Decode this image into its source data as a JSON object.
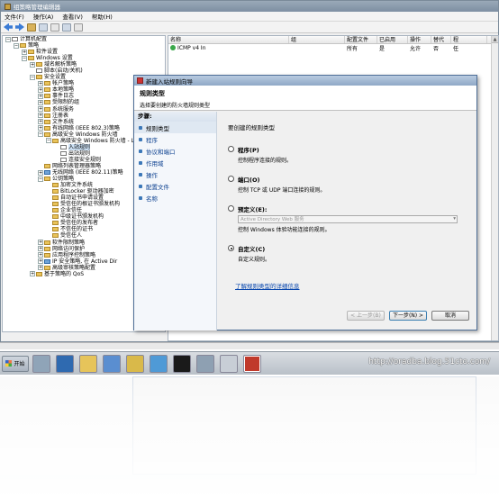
{
  "window": {
    "title": "组策略管理编辑器",
    "menu": [
      "文件(F)",
      "操作(A)",
      "查看(V)",
      "帮助(H)"
    ]
  },
  "tree": [
    {
      "indent": 0,
      "exp": "−",
      "icon": "doc",
      "label": "计算机配置"
    },
    {
      "indent": 1,
      "exp": "−",
      "icon": "folder",
      "label": "策略"
    },
    {
      "indent": 2,
      "exp": "+",
      "icon": "folder",
      "label": "软件设置"
    },
    {
      "indent": 2,
      "exp": "−",
      "icon": "folder",
      "label": "Windows 设置"
    },
    {
      "indent": 3,
      "exp": "+",
      "icon": "folder",
      "label": "域名解析策略"
    },
    {
      "indent": 3,
      "exp": "",
      "icon": "doc",
      "label": "脚本(启动/关机)"
    },
    {
      "indent": 3,
      "exp": "−",
      "icon": "folder",
      "label": "安全设置"
    },
    {
      "indent": 4,
      "exp": "+",
      "icon": "folder",
      "label": "帐户策略"
    },
    {
      "indent": 4,
      "exp": "+",
      "icon": "folder",
      "label": "本地策略"
    },
    {
      "indent": 4,
      "exp": "+",
      "icon": "folder",
      "label": "事件日志"
    },
    {
      "indent": 4,
      "exp": "+",
      "icon": "folder",
      "label": "受限制的组"
    },
    {
      "indent": 4,
      "exp": "+",
      "icon": "folder",
      "label": "系统服务"
    },
    {
      "indent": 4,
      "exp": "+",
      "icon": "folder",
      "label": "注册表"
    },
    {
      "indent": 4,
      "exp": "+",
      "icon": "folder",
      "label": "文件系统"
    },
    {
      "indent": 4,
      "exp": "+",
      "icon": "folder",
      "label": "有线网络 (IEEE 802.3)策略"
    },
    {
      "indent": 4,
      "exp": "−",
      "icon": "folder",
      "label": "高级安全 Windows 防火墙"
    },
    {
      "indent": 5,
      "exp": "−",
      "icon": "folder",
      "label": "高级安全 Windows 防火墙 - L"
    },
    {
      "indent": 6,
      "exp": "",
      "icon": "doc",
      "label": "入站规则",
      "sel": true
    },
    {
      "indent": 6,
      "exp": "",
      "icon": "doc",
      "label": "出站规则"
    },
    {
      "indent": 6,
      "exp": "",
      "icon": "doc",
      "label": "连接安全规则"
    },
    {
      "indent": 4,
      "exp": "",
      "icon": "folder",
      "label": "网络列表管理器策略"
    },
    {
      "indent": 4,
      "exp": "+",
      "icon": "net",
      "label": "无线网络 (IEEE 802.11)策略"
    },
    {
      "indent": 4,
      "exp": "−",
      "icon": "folder",
      "label": "公钥策略"
    },
    {
      "indent": 5,
      "exp": "",
      "icon": "folder",
      "label": "加密文件系统"
    },
    {
      "indent": 5,
      "exp": "",
      "icon": "folder",
      "label": "BitLocker 驱动器加密"
    },
    {
      "indent": 5,
      "exp": "",
      "icon": "folder",
      "label": "自动证书申请设置"
    },
    {
      "indent": 5,
      "exp": "",
      "icon": "folder",
      "label": "受信任的根证书颁发机构"
    },
    {
      "indent": 5,
      "exp": "",
      "icon": "folder",
      "label": "企业信任"
    },
    {
      "indent": 5,
      "exp": "",
      "icon": "folder",
      "label": "中级证书颁发机构"
    },
    {
      "indent": 5,
      "exp": "",
      "icon": "folder",
      "label": "受信任的发布者"
    },
    {
      "indent": 5,
      "exp": "",
      "icon": "folder",
      "label": "不信任的证书"
    },
    {
      "indent": 5,
      "exp": "",
      "icon": "folder",
      "label": "受信任人"
    },
    {
      "indent": 4,
      "exp": "+",
      "icon": "folder",
      "label": "软件限制策略"
    },
    {
      "indent": 4,
      "exp": "+",
      "icon": "folder",
      "label": "网络访问保护"
    },
    {
      "indent": 4,
      "exp": "+",
      "icon": "folder",
      "label": "应用程序控制策略"
    },
    {
      "indent": 4,
      "exp": "+",
      "icon": "net",
      "label": "IP 安全策略, 在 Active Dir"
    },
    {
      "indent": 4,
      "exp": "+",
      "icon": "folder",
      "label": "高级审核策略配置"
    },
    {
      "indent": 3,
      "exp": "+",
      "icon": "folder",
      "label": "基于策略的 QoS"
    }
  ],
  "list": {
    "columns": [
      "名称",
      "组",
      "配置文件",
      "已启用",
      "操作",
      "替代",
      "程"
    ],
    "rows": [
      {
        "name": "ICMP v4 In",
        "group": "",
        "profile": "所有",
        "enabled": "是",
        "action": "允许",
        "override": "否",
        "program": "任"
      }
    ]
  },
  "dialog": {
    "title": "新建入站规则向导",
    "header": "规则类型",
    "subheader": "选择要创建的防火墙规则类型",
    "steps_title": "步骤:",
    "steps": [
      "规则类型",
      "程序",
      "协议和端口",
      "作用域",
      "操作",
      "配置文件",
      "名称"
    ],
    "prompt": "要创建的规则类型",
    "options": [
      {
        "title": "程序(P)",
        "desc": "控制程序连接的规则。",
        "checked": false
      },
      {
        "title": "端口(O)",
        "desc": "控制 TCP 或 UDP 端口连接的规则。",
        "checked": false
      },
      {
        "title": "预定义(E):",
        "desc": "控制 Windows 体验功能连接的规则。",
        "checked": false,
        "combo": "Active Directory Web 服务"
      },
      {
        "title": "自定义(C)",
        "desc": "自定义规则。",
        "checked": true
      }
    ],
    "link": "了解规则类型的详细信息",
    "buttons": {
      "back": "< 上一步(B)",
      "next": "下一步(N) >",
      "cancel": "取消"
    }
  },
  "taskbar": {
    "start": "开始",
    "icon_colors": [
      "#8fa4b8",
      "#2f6ab0",
      "#e6c45a",
      "#5a8ed0",
      "#d9b94a",
      "#4f9ad6",
      "#1a1a1a",
      "#8ea0b2",
      "#c8ced6",
      "#c0392b"
    ]
  },
  "watermark": "http://oradba.blog.51cto.com/"
}
